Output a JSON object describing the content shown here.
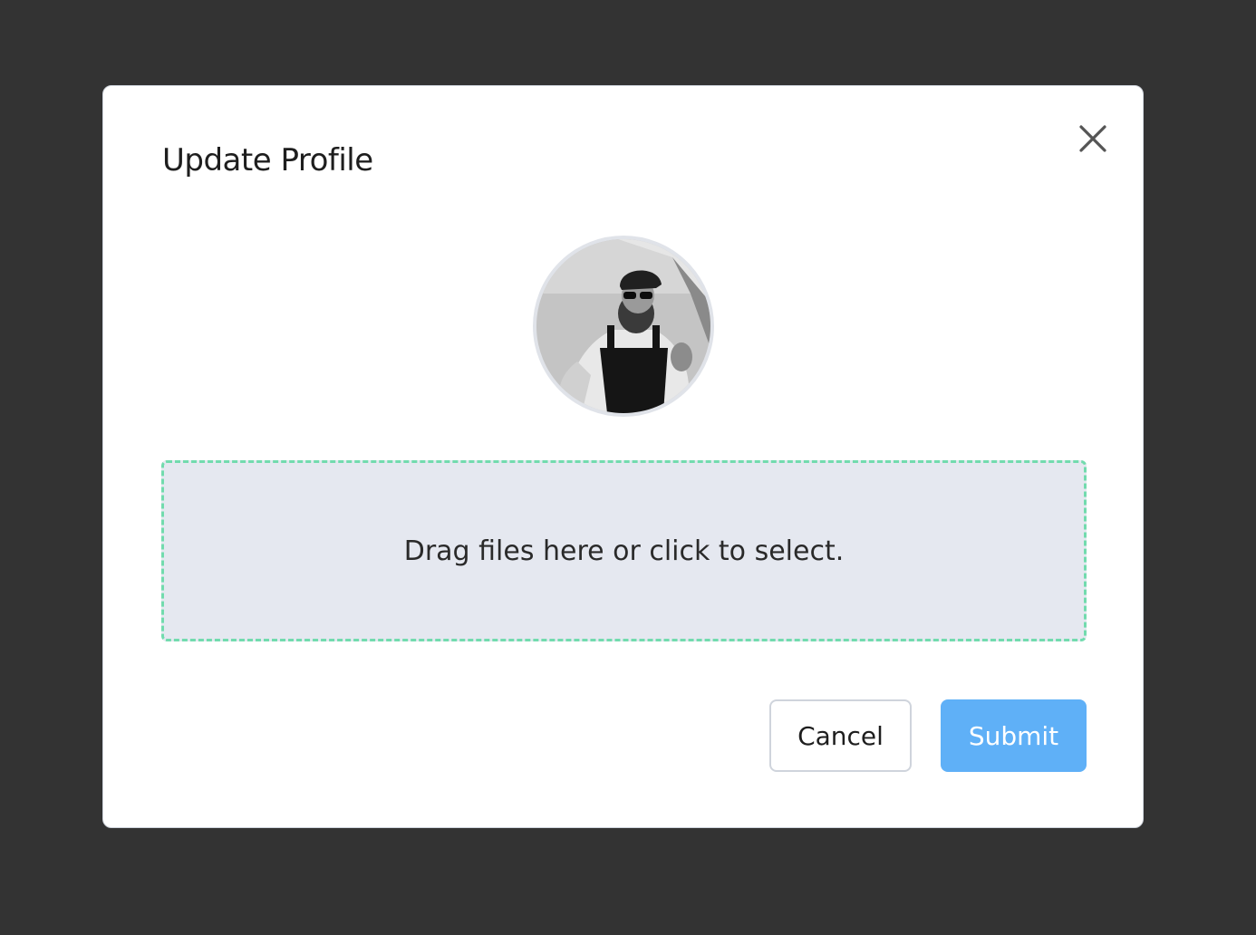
{
  "modal": {
    "title": "Update Profile",
    "close_icon": "close-icon"
  },
  "avatar": {
    "description_icon": "avatar-photo"
  },
  "dropzone": {
    "text": "Drag files here or click to select."
  },
  "actions": {
    "cancel_label": "Cancel",
    "submit_label": "Submit"
  },
  "colors": {
    "backdrop": "#333333",
    "submit": "#5fb0f7",
    "dropzone_border": "#72dbae",
    "dropzone_bg": "#e5e8f0"
  }
}
